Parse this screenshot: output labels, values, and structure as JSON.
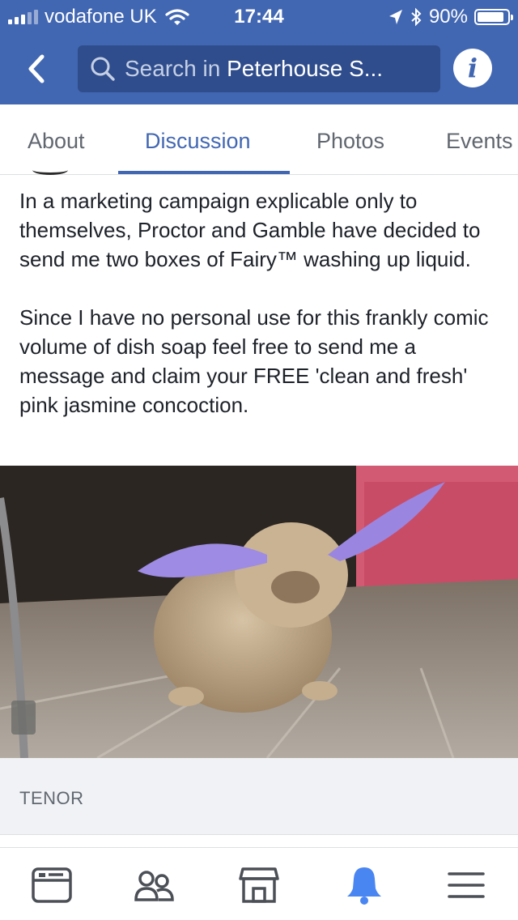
{
  "status_bar": {
    "carrier": "vodafone UK",
    "time": "17:44",
    "battery": "90%",
    "battery_level": 0.9
  },
  "header": {
    "search_prefix": "Search in ",
    "search_group": "Peterhouse S...",
    "info_label": "i",
    "icons": [
      "back-arrow",
      "search",
      "info"
    ]
  },
  "tabs": [
    {
      "label": "About",
      "active": false
    },
    {
      "label": "Discussion",
      "active": true
    },
    {
      "label": "Photos",
      "active": false
    },
    {
      "label": "Events",
      "active": false
    }
  ],
  "post": {
    "paragraph1": "In a marketing campaign explicable only to themselves, Proctor and Gamble have decided to send me two boxes of Fairy™ washing up liquid.",
    "paragraph2": "Since I have no personal use for this frankly comic volume of dish soap feel free to send me a message and claim your FREE 'clean and fresh' pink jasmine concoction.",
    "gif_source": "TENOR"
  },
  "bottom_nav": {
    "items": [
      "news-feed",
      "groups",
      "marketplace",
      "notifications",
      "menu"
    ],
    "active": "notifications"
  },
  "colors": {
    "brand_blue": "#4267b2",
    "search_bg": "#2f4d8c",
    "muted_text": "#616770"
  }
}
